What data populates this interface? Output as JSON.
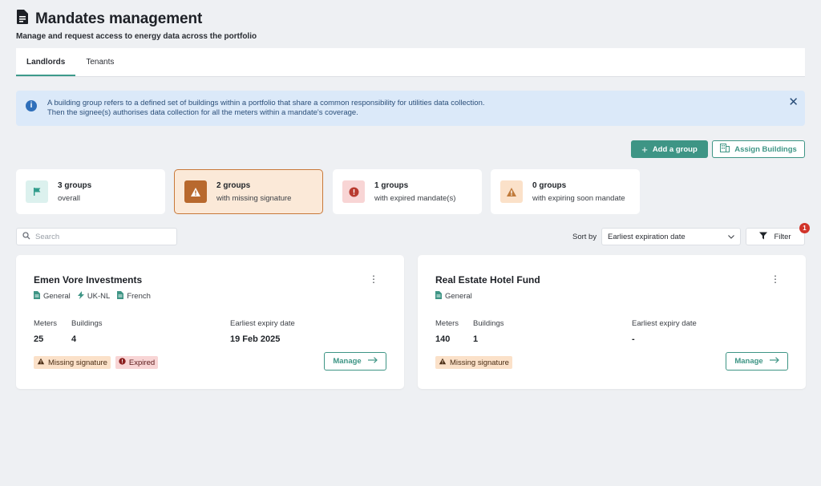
{
  "header": {
    "title": "Mandates management",
    "subtitle": "Manage and request access to energy data across the portfolio"
  },
  "tabs": [
    {
      "label": "Landlords",
      "active": true
    },
    {
      "label": "Tenants",
      "active": false
    }
  ],
  "info_banner": {
    "icon": "info-icon",
    "line1": "A building group refers to a defined set of buildings within a portfolio that share a common responsibility for utilities data collection.",
    "line2": "Then the signee(s) authorises data collection for all the meters within a mandate's coverage.",
    "close": "✕"
  },
  "actions": {
    "add_group": "Add a group",
    "assign_buildings": "Assign Buildings"
  },
  "stats": [
    {
      "count": "3 groups",
      "label": "overall",
      "icon": "flag-icon",
      "color": "#2f9c8b"
    },
    {
      "count": "2 groups",
      "label": "with missing signature",
      "icon": "warning-icon",
      "color": "#b8692e",
      "selected": true
    },
    {
      "count": "1 groups",
      "label": "with expired mandate(s)",
      "icon": "alert-circle-icon",
      "color": "#c0392b"
    },
    {
      "count": "0 groups",
      "label": "with expiring soon mandate",
      "icon": "warning-icon",
      "color": "#c07a3a"
    }
  ],
  "toolbar": {
    "search_placeholder": "Search",
    "sort_label": "Sort by",
    "sort_value": "Earliest expiration date",
    "filter_label": "Filter",
    "filter_count": "1"
  },
  "groups": [
    {
      "name": "Emen Vore Investments",
      "tags": [
        {
          "label": "General",
          "icon": "document-icon"
        },
        {
          "label": "UK-NL",
          "icon": "lightning-icon"
        },
        {
          "label": "French",
          "icon": "document-icon"
        }
      ],
      "meters_label": "Meters",
      "meters": "25",
      "buildings_label": "Buildings",
      "buildings": "4",
      "expiry_label": "Earliest expiry date",
      "expiry": "19 Feb 2025",
      "badges": [
        {
          "label": "Missing signature",
          "kind": "warn"
        },
        {
          "label": "Expired",
          "kind": "err"
        }
      ],
      "manage": "Manage"
    },
    {
      "name": "Real Estate Hotel Fund",
      "tags": [
        {
          "label": "General",
          "icon": "document-icon"
        }
      ],
      "meters_label": "Meters",
      "meters": "140",
      "buildings_label": "Buildings",
      "buildings": "1",
      "expiry_label": "Earliest expiry date",
      "expiry": "-",
      "badges": [
        {
          "label": "Missing signature",
          "kind": "warn"
        }
      ],
      "manage": "Manage"
    }
  ]
}
